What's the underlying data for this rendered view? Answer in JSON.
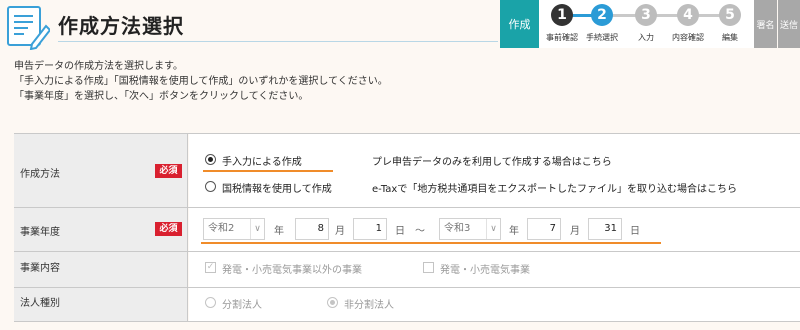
{
  "header": {
    "title": "作成方法選択"
  },
  "steps": {
    "current_label": "作成",
    "items": [
      {
        "num": "1",
        "label": "事前確認",
        "color": "#333333"
      },
      {
        "num": "2",
        "label": "手続選択",
        "color": "#2b9bd6"
      },
      {
        "num": "3",
        "label": "入力",
        "color": "#bdbdbd"
      },
      {
        "num": "4",
        "label": "内容確認",
        "color": "#bdbdbd"
      },
      {
        "num": "5",
        "label": "編集",
        "color": "#bdbdbd"
      }
    ],
    "tail": [
      "署名",
      "送信"
    ]
  },
  "intro": [
    "申告データの作成方法を選択します。",
    "「手入力による作成」「国税情報を使用して作成」のいずれかを選択してください。",
    "「事業年度」を選択し、「次へ」ボタンをクリックしてください。"
  ],
  "form": {
    "required_badge": "必須",
    "method": {
      "label": "作成方法",
      "options": [
        {
          "text": "手入力による作成",
          "selected": true,
          "desc": "プレ申告データのみを利用して作成する場合はこちら"
        },
        {
          "text": "国税情報を使用して作成",
          "selected": false,
          "desc": "e-Taxで「地方税共通項目をエクスポートしたファイル」を取り込む場合はこちら"
        }
      ]
    },
    "fiscal_year": {
      "label": "事業年度",
      "start": {
        "era": "令和2",
        "month": "8",
        "day": "1"
      },
      "end": {
        "era": "令和3",
        "month": "7",
        "day": "31"
      },
      "unit_year": "年",
      "unit_month": "月",
      "unit_day": "日",
      "separator": "～"
    },
    "business": {
      "label": "事業内容",
      "options": [
        {
          "text": "発電・小売電気事業以外の事業",
          "checked": true
        },
        {
          "text": "発電・小売電気事業",
          "checked": false
        }
      ]
    },
    "corp_type": {
      "label": "法人種別",
      "options": [
        {
          "text": "分割法人",
          "selected": false
        },
        {
          "text": "非分割法人",
          "selected": true
        }
      ]
    }
  },
  "colors": {
    "accent": "#1aa3a8",
    "required": "#d9202f",
    "underline": "#f08c2a"
  }
}
